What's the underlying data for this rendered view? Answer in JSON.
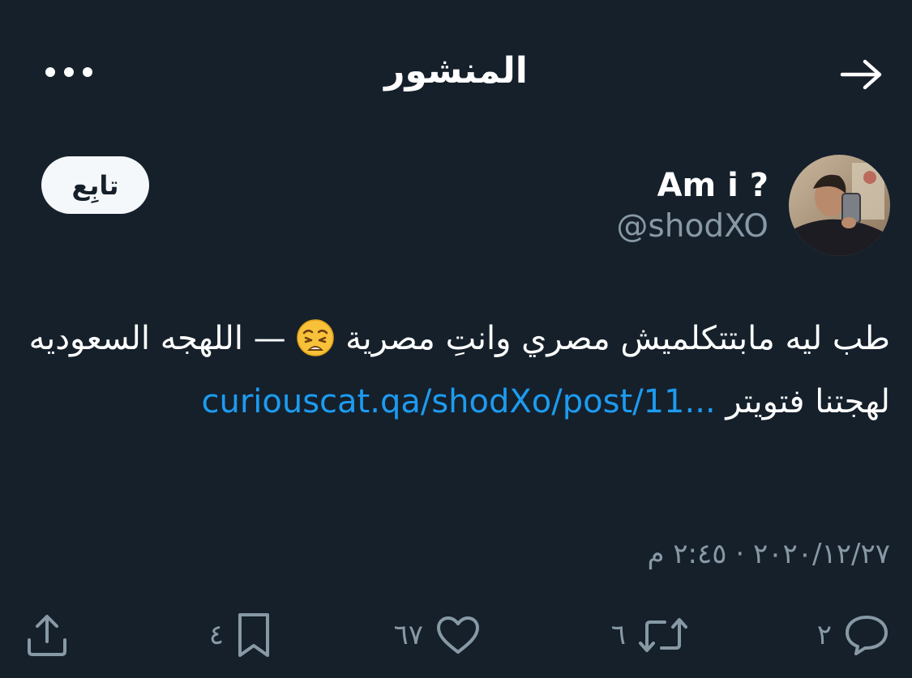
{
  "header": {
    "title": "المنشور"
  },
  "author": {
    "display_name": "Am i ?",
    "handle": "@shodXO",
    "follow_label": "تابِع"
  },
  "tweet": {
    "text_part1": "طب ليه مابتتكلميش مصري وانتِ مصرية",
    "text_part2": "— اللهجه السعوديه لهجتنا فتويتر",
    "link": "curiouscat.qa/shodXo/post/11...",
    "timestamp": "٢٠٢٠/١٢/٢٧ · ٢:٤٥ م"
  },
  "actions": {
    "reply_count": "٢",
    "retweet_count": "٦",
    "like_count": "٦٧",
    "bookmark_count": "٤"
  },
  "colors": {
    "background": "#15202b",
    "link": "#1d9bf0",
    "secondary_text": "#8899a6",
    "follow_button_bg": "#f5f8fa"
  }
}
